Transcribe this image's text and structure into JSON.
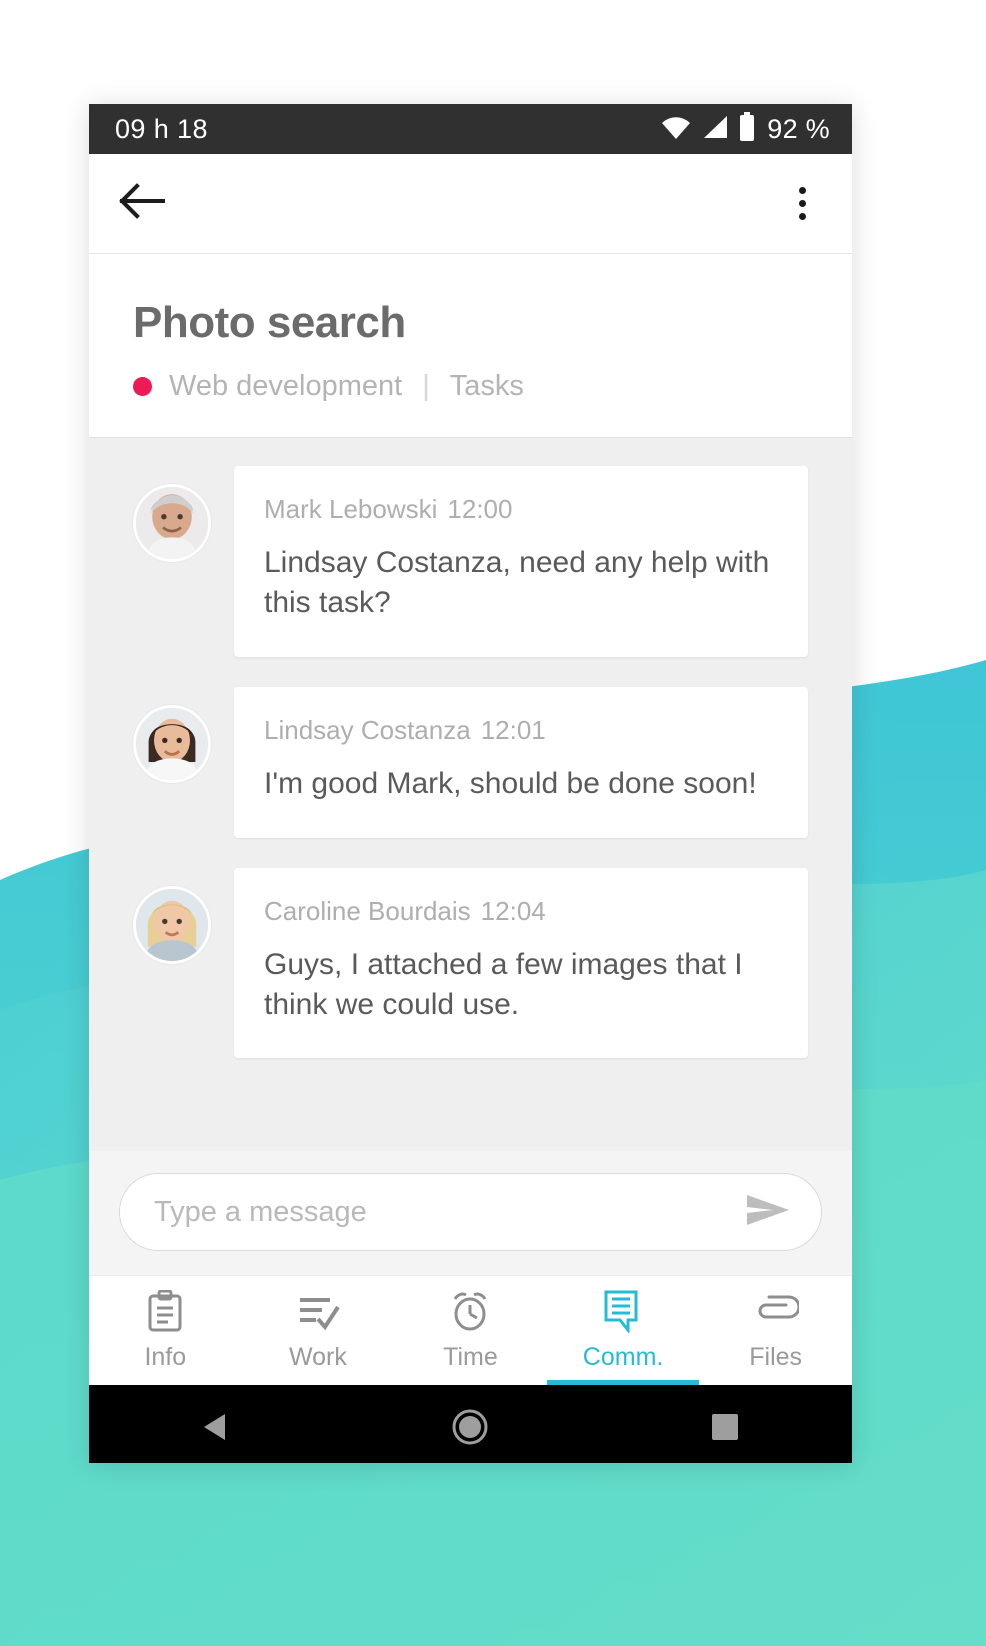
{
  "statusbar": {
    "time": "09 h 18",
    "battery_text": "92 %",
    "icons": [
      "wifi-icon",
      "signal-icon",
      "battery-icon"
    ]
  },
  "appbar": {
    "back_icon": "arrow-back-icon",
    "overflow_icon": "more-vertical-icon"
  },
  "header": {
    "title": "Photo search",
    "project_dot_color": "#ed1b55",
    "project": "Web development",
    "separator": "|",
    "section": "Tasks"
  },
  "chat": {
    "messages": [
      {
        "author": "Mark Lebowski",
        "time": "12:00",
        "text": "Lindsay Costanza, need any help with this task?",
        "avatar": "avatar-mark"
      },
      {
        "author": "Lindsay Costanza",
        "time": "12:01",
        "text": "I'm good Mark, should be done soon!",
        "avatar": "avatar-lindsay"
      },
      {
        "author": "Caroline Bourdais",
        "time": "12:04",
        "text": "Guys, I attached a few images that I think we could use.",
        "avatar": "avatar-caroline"
      }
    ]
  },
  "composer": {
    "placeholder": "Type a message",
    "value": "",
    "send_icon": "send-icon"
  },
  "tabbar": {
    "active_color": "#23bcd4",
    "inactive_color": "#9a9a9a",
    "tabs": [
      {
        "label": "Info",
        "icon": "clipboard-icon",
        "active": false
      },
      {
        "label": "Work",
        "icon": "list-check-icon",
        "active": false
      },
      {
        "label": "Time",
        "icon": "alarm-clock-icon",
        "active": false
      },
      {
        "label": "Comm.",
        "icon": "chat-bubble-icon",
        "active": true
      },
      {
        "label": "Files",
        "icon": "paperclip-icon",
        "active": false
      }
    ]
  },
  "sysnav": {
    "buttons": [
      {
        "icon": "nav-back-icon"
      },
      {
        "icon": "nav-home-icon"
      },
      {
        "icon": "nav-recents-icon"
      }
    ]
  }
}
